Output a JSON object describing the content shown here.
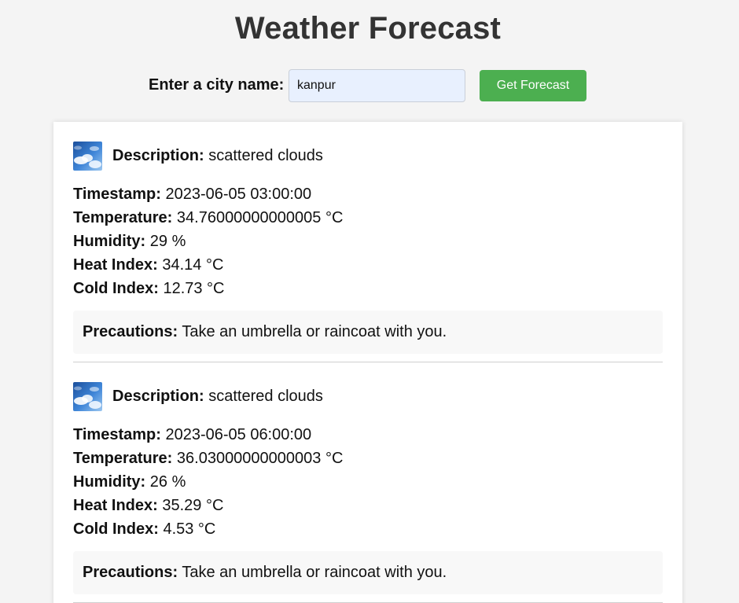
{
  "header": {
    "title": "Weather Forecast"
  },
  "search": {
    "label": "Enter a city name:",
    "value": "kanpur",
    "button_label": "Get Forecast"
  },
  "labels": {
    "description": "Description:",
    "timestamp": "Timestamp:",
    "temperature": "Temperature:",
    "humidity": "Humidity:",
    "heat_index": "Heat Index:",
    "cold_index": "Cold Index:",
    "precautions": "Precautions:"
  },
  "forecasts": [
    {
      "icon": "scattered-clouds-icon",
      "description": "scattered clouds",
      "timestamp": "2023-06-05 03:00:00",
      "temperature": "34.76000000000005 °C",
      "humidity": "29 %",
      "heat_index": "34.14 °C",
      "cold_index": "12.73 °C",
      "precautions": "Take an umbrella or raincoat with you."
    },
    {
      "icon": "scattered-clouds-icon",
      "description": "scattered clouds",
      "timestamp": "2023-06-05 06:00:00",
      "temperature": "36.03000000000003 °C",
      "humidity": "26 %",
      "heat_index": "35.29 °C",
      "cold_index": "4.53 °C",
      "precautions": "Take an umbrella or raincoat with you."
    }
  ],
  "colors": {
    "background": "#f4f4f4",
    "accent": "#4caf50",
    "title": "#333333",
    "input_background": "#e8f0fe"
  }
}
